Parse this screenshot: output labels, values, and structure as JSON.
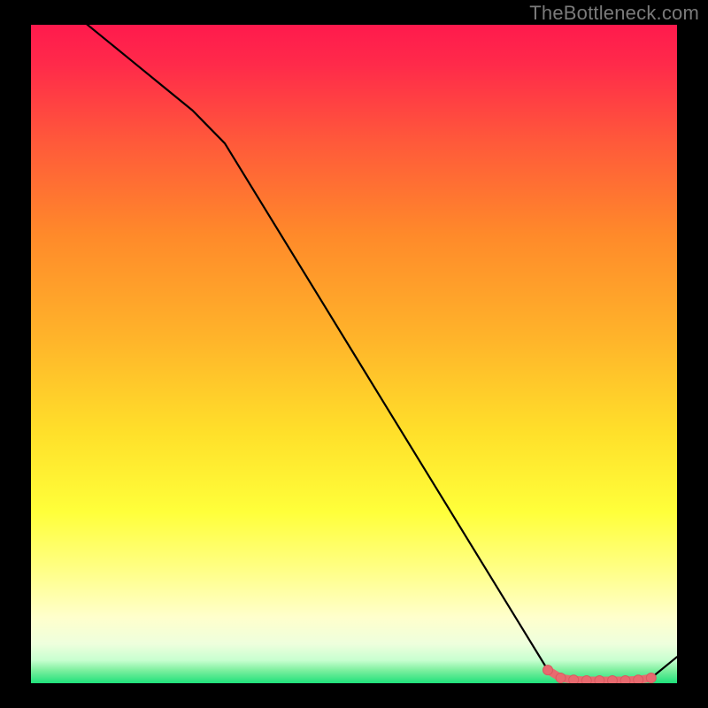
{
  "watermark": "TheBottleneck.com",
  "colors": {
    "bg": "#000000",
    "grad_top": "#ff1a4d",
    "grad_mid1": "#ff8a2a",
    "grad_mid2": "#ffe02a",
    "grad_mid3": "#ffff66",
    "grad_mid4": "#ffffcc",
    "grad_bottom": "#1fe07a",
    "line": "#000000",
    "marker_fill": "#e86a6f",
    "marker_stroke": "#d95a60"
  },
  "chart_data": {
    "type": "line",
    "title": "",
    "xlabel": "",
    "ylabel": "",
    "xlim": [
      0,
      100
    ],
    "ylim": [
      0,
      100
    ],
    "grid": false,
    "legend": false,
    "series": [
      {
        "name": "curve",
        "x": [
          0,
          5,
          10,
          15,
          20,
          25,
          30,
          35,
          40,
          45,
          50,
          55,
          60,
          65,
          70,
          75,
          80,
          82,
          84,
          86,
          88,
          90,
          92,
          94,
          96,
          100
        ],
        "y": [
          107,
          103,
          99,
          95,
          91,
          87,
          82,
          74,
          66,
          58,
          50,
          42,
          34,
          26,
          18,
          10,
          2,
          0.8,
          0.5,
          0.4,
          0.4,
          0.4,
          0.4,
          0.5,
          0.8,
          4
        ]
      }
    ],
    "highlight_segment": {
      "name": "valley-highlight",
      "x": [
        80,
        82,
        84,
        86,
        88,
        90,
        92,
        94,
        96
      ],
      "y": [
        2,
        0.8,
        0.5,
        0.4,
        0.4,
        0.4,
        0.4,
        0.5,
        0.8
      ]
    }
  }
}
